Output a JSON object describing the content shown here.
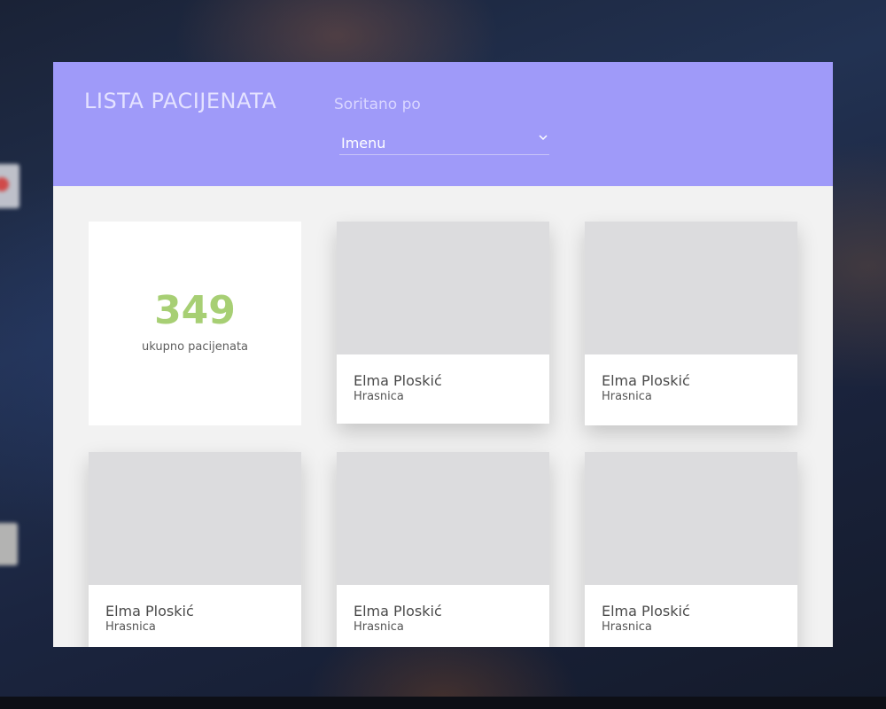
{
  "header": {
    "title": "LISTA PACIJENATA",
    "sort_label": "Soritano po",
    "sort_value": "Imenu",
    "background_color": "#9f9af9"
  },
  "stats": {
    "total_value": "349",
    "total_label": "ukupno pacijenata",
    "value_color": "#a7cf74"
  },
  "patients": [
    {
      "name": "Elma Ploskić",
      "location": "Hrasnica"
    },
    {
      "name": "Elma Ploskić",
      "location": "Hrasnica"
    },
    {
      "name": "Elma Ploskić",
      "location": "Hrasnica"
    },
    {
      "name": "Elma Ploskić",
      "location": "Hrasnica"
    },
    {
      "name": "Elma Ploskić",
      "location": "Hrasnica"
    }
  ],
  "icons": {
    "sort_chevron": "chevron-down-icon"
  }
}
